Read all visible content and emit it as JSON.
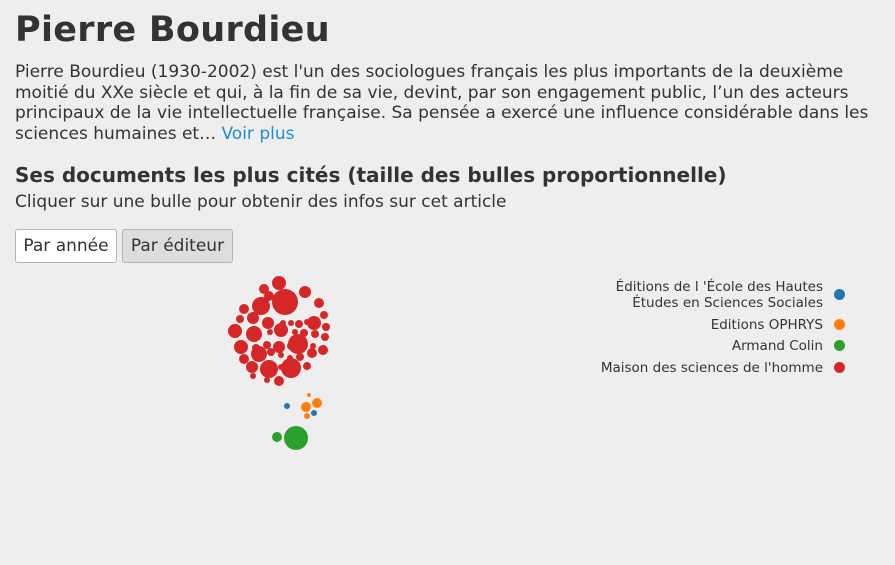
{
  "profile": {
    "name": "Pierre Bourdieu",
    "bio": "Pierre Bourdieu (1930-2002) est l'un des sociologues français les plus importants de la deuxième moitié du XXe siècle et qui, à la fin de sa vie, devint, par son engagement public, l’un des acteurs principaux de la vie intellectuelle française. Sa pensée a exercé une influence considérable dans les sciences humaines et… ",
    "more_link": "Voir plus"
  },
  "section": {
    "title": "Ses documents les plus cités (taille des bulles proportionnelle)",
    "hint": "Cliquer sur une bulle pour obtenir des infos sur cet article"
  },
  "buttons": {
    "by_year": "Par année",
    "by_publisher": "Par éditeur"
  },
  "legend": [
    {
      "label": "Éditions de l 'École des Hautes\nÉtudes en Sciences Sociales",
      "color": "#1f77b4"
    },
    {
      "label": "Editions OPHRYS",
      "color": "#ff7f0e"
    },
    {
      "label": "Armand Colin",
      "color": "#2ca02c"
    },
    {
      "label": "Maison des sciences de l'homme",
      "color": "#d62728"
    }
  ]
}
